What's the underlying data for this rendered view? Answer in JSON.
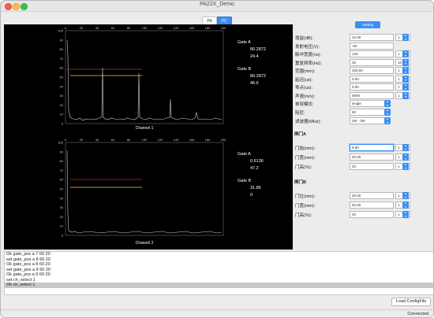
{
  "window": {
    "title": "PA22X_Demo"
  },
  "tabs": [
    {
      "label": "PA",
      "active": false
    },
    {
      "label": "PC",
      "active": true
    }
  ],
  "setting_button": "Setting",
  "plots": [
    {
      "caption": "Channel 1",
      "x_ticks": [
        "0",
        "20",
        "40",
        "60",
        "80",
        "100",
        "120",
        "140",
        "160",
        "180",
        "200"
      ],
      "y_ticks": [
        "100",
        "90",
        "80",
        "70",
        "60",
        "50",
        "40",
        "30",
        "20",
        "10",
        "0"
      ],
      "gate_a": {
        "label": "Gate A",
        "value1": "80.2872",
        "value2": "24.4"
      },
      "gate_b": {
        "label": "Gate B",
        "value1": "80.2872",
        "value2": "46.6"
      }
    },
    {
      "caption": "Channel 2",
      "x_ticks": [
        "0",
        "20",
        "40",
        "60",
        "80",
        "100",
        "120",
        "140",
        "160",
        "180",
        "200"
      ],
      "y_ticks": [
        "100",
        "90",
        "80",
        "70",
        "60",
        "50",
        "40",
        "30",
        "20",
        "10",
        "0"
      ],
      "gate_a": {
        "label": "Gate A",
        "value1": "0.6136",
        "value2": "47.2"
      },
      "gate_b": {
        "label": "Gate B",
        "value1": "31.86",
        "value2": "0"
      }
    }
  ],
  "settings": {
    "rows": [
      {
        "label": "增益(dB):",
        "value": "34.09",
        "step": "1"
      },
      {
        "label": "发射电压(V):",
        "value": "-50",
        "step": ""
      },
      {
        "label": "脉冲宽度(ns):",
        "value": "125",
        "step": "1"
      },
      {
        "label": "重复频率(Hz):",
        "value": "25",
        "step": "10"
      },
      {
        "label": "范围(mm):",
        "value": "200.00",
        "step": "1"
      },
      {
        "label": "延迟(us):",
        "value": "0.00",
        "step": "1"
      },
      {
        "label": "零点(us):",
        "value": "0.00",
        "step": "1"
      },
      {
        "label": "声速(m/s):",
        "value": "5900",
        "step": "1"
      }
    ],
    "selects": [
      {
        "label": "单双模式:",
        "value": "single"
      },
      {
        "label": "阻尼:",
        "value": "80"
      },
      {
        "label": "滤波器(MHz):",
        "value": "2M - 3M"
      }
    ],
    "gate_a_title": "闸门A",
    "gate_a_rows": [
      {
        "label": "门始(mm):",
        "value": "9.60",
        "step": "1"
      },
      {
        "label": "门宽(mm):",
        "value": "60.00",
        "step": "1"
      },
      {
        "label": "门高(%):",
        "value": "20",
        "step": "1"
      }
    ],
    "gate_b_title": "闸门B",
    "gate_b_rows": [
      {
        "label": "门位(mm):",
        "value": "20.00",
        "step": "1"
      },
      {
        "label": "门宽(mm):",
        "value": "50.00",
        "step": "1"
      },
      {
        "label": "门高(%):",
        "value": "40",
        "step": "1"
      }
    ]
  },
  "log": [
    "Ok gate_pos a 7 60 20",
    "set gate_pos a 8 60 20",
    "Ok gate_pos a 8 60 20",
    "set gate_pos a 9 60 20",
    "Ok gate_pos a 9 60 20",
    "set ch_select 1",
    "Ok ch_select 1"
  ],
  "load_button": "Load ConfigFile",
  "status": "Connected"
}
